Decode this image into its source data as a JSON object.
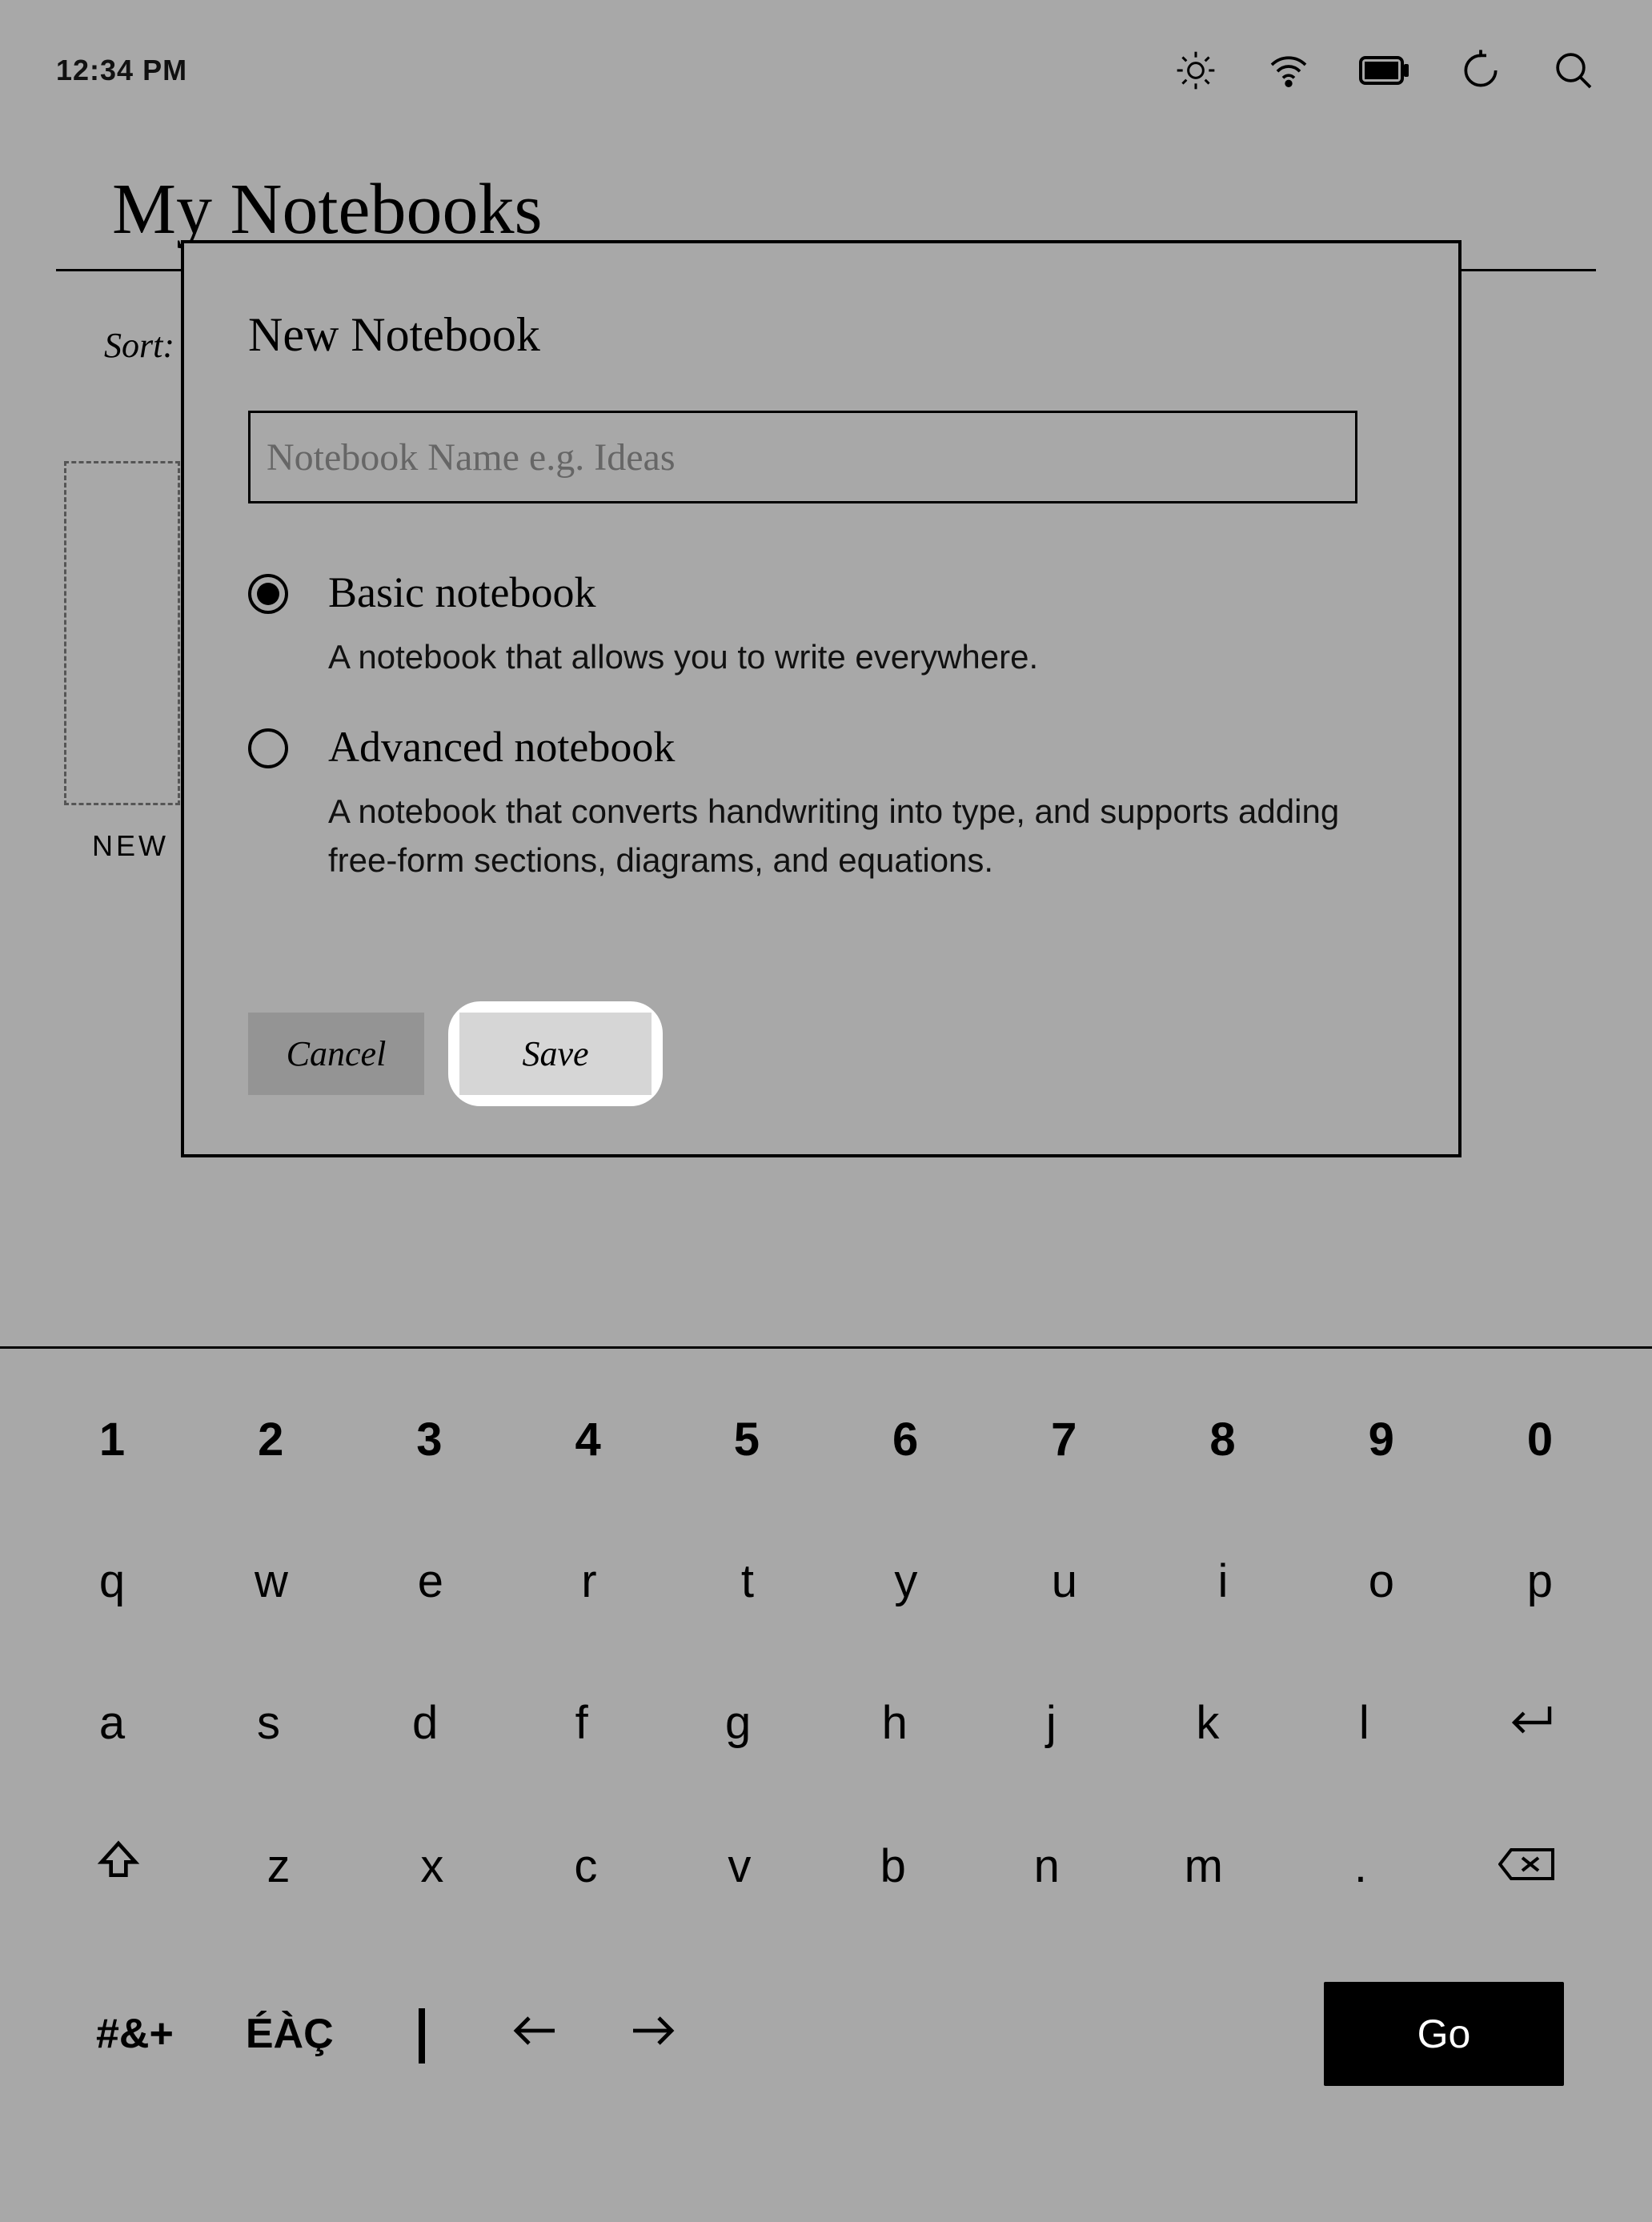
{
  "status": {
    "time": "12:34 PM"
  },
  "page": {
    "title": "My Notebooks",
    "sort_label": "Sort:",
    "new_card_label": "NEW"
  },
  "dialog": {
    "title": "New Notebook",
    "input_placeholder": "Notebook Name e.g. Ideas",
    "input_value": "",
    "options": [
      {
        "title": "Basic notebook",
        "description": "A notebook that allows you to write everywhere.",
        "selected": true
      },
      {
        "title": "Advanced notebook",
        "description": "A notebook that converts handwriting into type, and supports adding free-form sections, diagrams, and equations.",
        "selected": false
      }
    ],
    "cancel_label": "Cancel",
    "save_label": "Save"
  },
  "keyboard": {
    "row1": [
      "1",
      "2",
      "3",
      "4",
      "5",
      "6",
      "7",
      "8",
      "9",
      "0"
    ],
    "row2": [
      "q",
      "w",
      "e",
      "r",
      "t",
      "y",
      "u",
      "i",
      "o",
      "p"
    ],
    "row3": [
      "a",
      "s",
      "d",
      "f",
      "g",
      "h",
      "j",
      "k",
      "l"
    ],
    "row4": [
      "z",
      "x",
      "c",
      "v",
      "b",
      "n",
      "m",
      "."
    ],
    "symbols_label": "#&+",
    "accents_label": "ÉÀÇ",
    "go_label": "Go"
  }
}
